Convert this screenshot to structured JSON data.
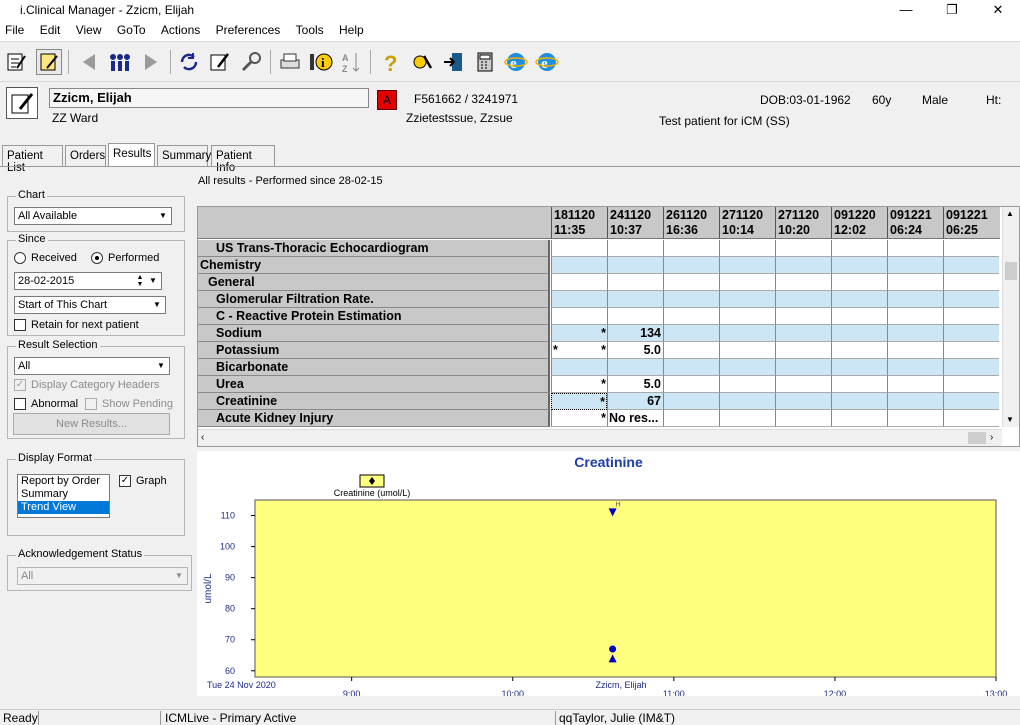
{
  "window": {
    "title": "i.Clinical Manager - Zzicm, Elijah",
    "minimize": "—",
    "maximize": "❐",
    "close": "✕"
  },
  "menu": [
    "File",
    "Edit",
    "View",
    "GoTo",
    "Actions",
    "Preferences",
    "Tools",
    "Help"
  ],
  "toolbar": {
    "icons": [
      "patient-list-icon",
      "patient-select-icon",
      "back-arrow-icon",
      "people-icon",
      "forward-arrow-icon",
      "refresh-icon",
      "edit-notes-icon",
      "search-key-icon",
      "printer-icon",
      "info-icon",
      "sort-az-icon",
      "help-icon",
      "tools-icon",
      "exit-icon",
      "calculator-icon",
      "browser-icon",
      "browser-icon-2"
    ]
  },
  "patient": {
    "name": "Zzicm, Elijah",
    "ward": "ZZ Ward",
    "alert": "A",
    "ids": "F561662 / 3241971",
    "consultant": "Zzietestssue, Zzsue",
    "dob": "DOB:03-01-1962",
    "age": "60y",
    "sex": "Male",
    "ht": "Ht:",
    "note": "Test patient for iCM (SS)"
  },
  "tabs": [
    "Patient List",
    "Orders",
    "Results",
    "Summary",
    "Patient Info"
  ],
  "left": {
    "chart_label": "Chart",
    "chart_value": "All Available",
    "since_label": "Since",
    "received": "Received",
    "performed": "Performed",
    "date": "28-02-2015",
    "start_value": "Start of This Chart",
    "retain": "Retain for next patient",
    "result_selection_label": "Result Selection",
    "result_value": "All",
    "display_headers": "Display Category Headers",
    "abnormal": "Abnormal",
    "show_pending": "Show Pending",
    "new_results": "New Results...",
    "display_format_label": "Display Format",
    "formats": [
      "Report by Order",
      "Summary",
      "Trend View"
    ],
    "graph": "Graph",
    "ack_label": "Acknowledgement Status",
    "ack_value": "All"
  },
  "results_caption": "All results - Performed since 28-02-15",
  "grid": {
    "columns": [
      {
        "d": "181120",
        "t": "11:35"
      },
      {
        "d": "241120",
        "t": "10:37"
      },
      {
        "d": "261120",
        "t": "16:36"
      },
      {
        "d": "271120",
        "t": "10:14"
      },
      {
        "d": "271120",
        "t": "10:20"
      },
      {
        "d": "091220",
        "t": "12:02"
      },
      {
        "d": "091221",
        "t": "06:24"
      },
      {
        "d": "091221",
        "t": "06:25"
      }
    ],
    "rows": [
      {
        "label": "US Trans-Thoracic Echocardiogram",
        "indent": 2,
        "blue": false,
        "cells": [
          "",
          "",
          "",
          "",
          "",
          "",
          "",
          ""
        ]
      },
      {
        "label": "Chemistry",
        "indent": 0,
        "blue": true,
        "cells": [
          "",
          "",
          "",
          "",
          "",
          "",
          "",
          ""
        ]
      },
      {
        "label": "General",
        "indent": 1,
        "blue": false,
        "cells": [
          "",
          "",
          "",
          "",
          "",
          "",
          "",
          ""
        ]
      },
      {
        "label": "Glomerular Filtration Rate.",
        "indent": 2,
        "blue": true,
        "cells": [
          "",
          "",
          "",
          "",
          "",
          "",
          "",
          ""
        ]
      },
      {
        "label": "C - Reactive Protein Estimation",
        "indent": 2,
        "blue": false,
        "cells": [
          "",
          "",
          "",
          "",
          "",
          "",
          "",
          ""
        ]
      },
      {
        "label": "Sodium",
        "indent": 2,
        "blue": true,
        "cells": [
          "*",
          "134",
          "",
          "",
          "",
          "",
          "",
          ""
        ]
      },
      {
        "label": "Potassium",
        "indent": 2,
        "blue": false,
        "cells": [
          "*   *",
          "5.0",
          "",
          "",
          "",
          "",
          "",
          ""
        ]
      },
      {
        "label": "Bicarbonate",
        "indent": 2,
        "blue": true,
        "cells": [
          "",
          "",
          "",
          "",
          "",
          "",
          "",
          ""
        ]
      },
      {
        "label": "Urea",
        "indent": 2,
        "blue": false,
        "cells": [
          "*",
          "5.0",
          "",
          "",
          "",
          "",
          "",
          ""
        ]
      },
      {
        "label": "Creatinine",
        "indent": 2,
        "blue": true,
        "cells": [
          "*",
          "67",
          "",
          "",
          "",
          "",
          "",
          ""
        ]
      },
      {
        "label": "Acute Kidney Injury",
        "indent": 2,
        "blue": false,
        "cells": [
          "*",
          "No res...",
          "",
          "",
          "",
          "",
          "",
          ""
        ]
      }
    ]
  },
  "chart_data": {
    "type": "scatter",
    "title": "Creatinine",
    "legend": "Creatinine (umol/L)",
    "ylabel": "umol/L",
    "yticks": [
      "60",
      "70",
      "80",
      "90",
      "100",
      "110"
    ],
    "xticks": [
      "9:00",
      "10:00",
      "11:00",
      "12:00",
      "13:00"
    ],
    "ylim": [
      58,
      115
    ],
    "xlim": [
      8.4,
      13.0
    ],
    "date_label": "Tue 24 Nov 2020",
    "patient_label": "Zzicm, Elijah",
    "flag_label": "H",
    "points": [
      {
        "x": 10.62,
        "y": 111,
        "marker": "down-triangle"
      },
      {
        "x": 10.62,
        "y": 67,
        "marker": "circle"
      },
      {
        "x": 10.62,
        "y": 64,
        "marker": "up-triangle"
      }
    ],
    "plot_bg": "#ffff80",
    "marker_color": "#0000c8"
  },
  "status": {
    "ready": "Ready",
    "server": "ICMLive - Primary Active",
    "user": "qqTaylor, Julie (IM&T)"
  }
}
